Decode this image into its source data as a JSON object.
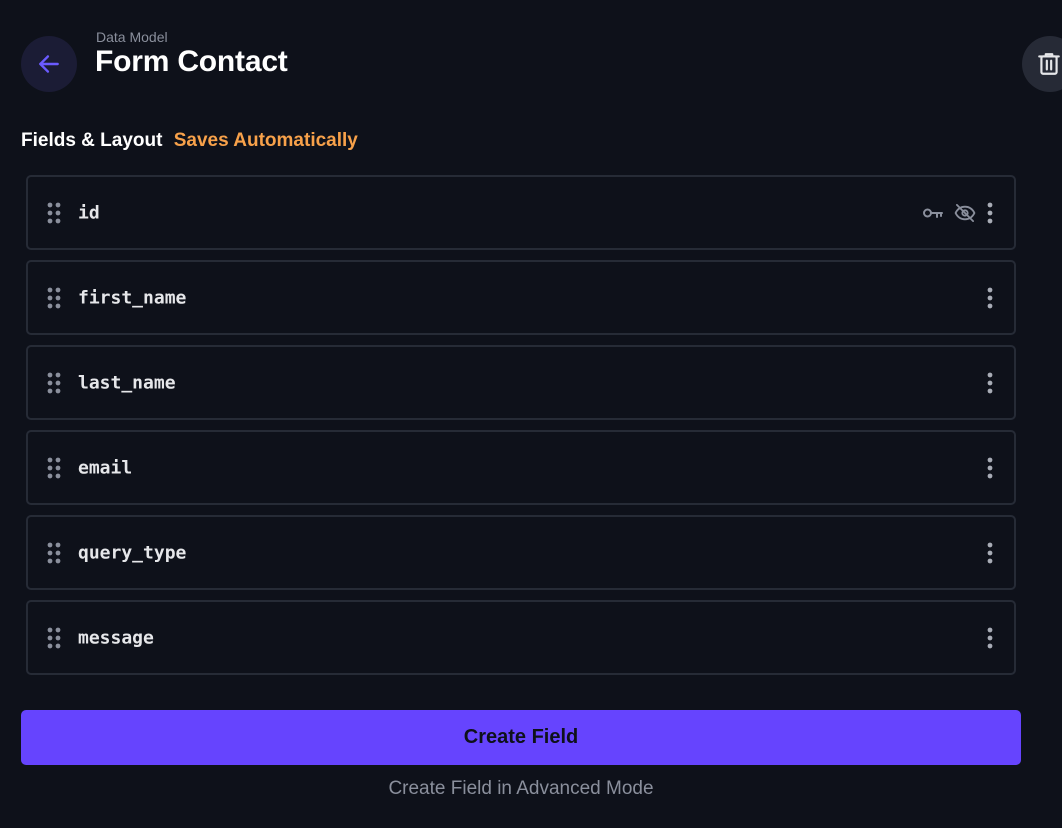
{
  "header": {
    "breadcrumb": "Data Model",
    "title": "Form Contact",
    "back_icon": "arrow-left-icon",
    "delete_icon": "trash-icon"
  },
  "section": {
    "title": "Fields & Layout",
    "status": "Saves Automatically"
  },
  "fields": [
    {
      "name": "id",
      "primary_key": true,
      "hidden": true
    },
    {
      "name": "first_name",
      "primary_key": false,
      "hidden": false
    },
    {
      "name": "last_name",
      "primary_key": false,
      "hidden": false
    },
    {
      "name": "email",
      "primary_key": false,
      "hidden": false
    },
    {
      "name": "query_type",
      "primary_key": false,
      "hidden": false
    },
    {
      "name": "message",
      "primary_key": false,
      "hidden": false
    }
  ],
  "actions": {
    "create_label": "Create Field",
    "advanced_label": "Create Field in Advanced Mode"
  },
  "colors": {
    "background": "#0e111a",
    "accent": "#6644fe",
    "status": "#f7a14a",
    "border": "#262b36"
  }
}
